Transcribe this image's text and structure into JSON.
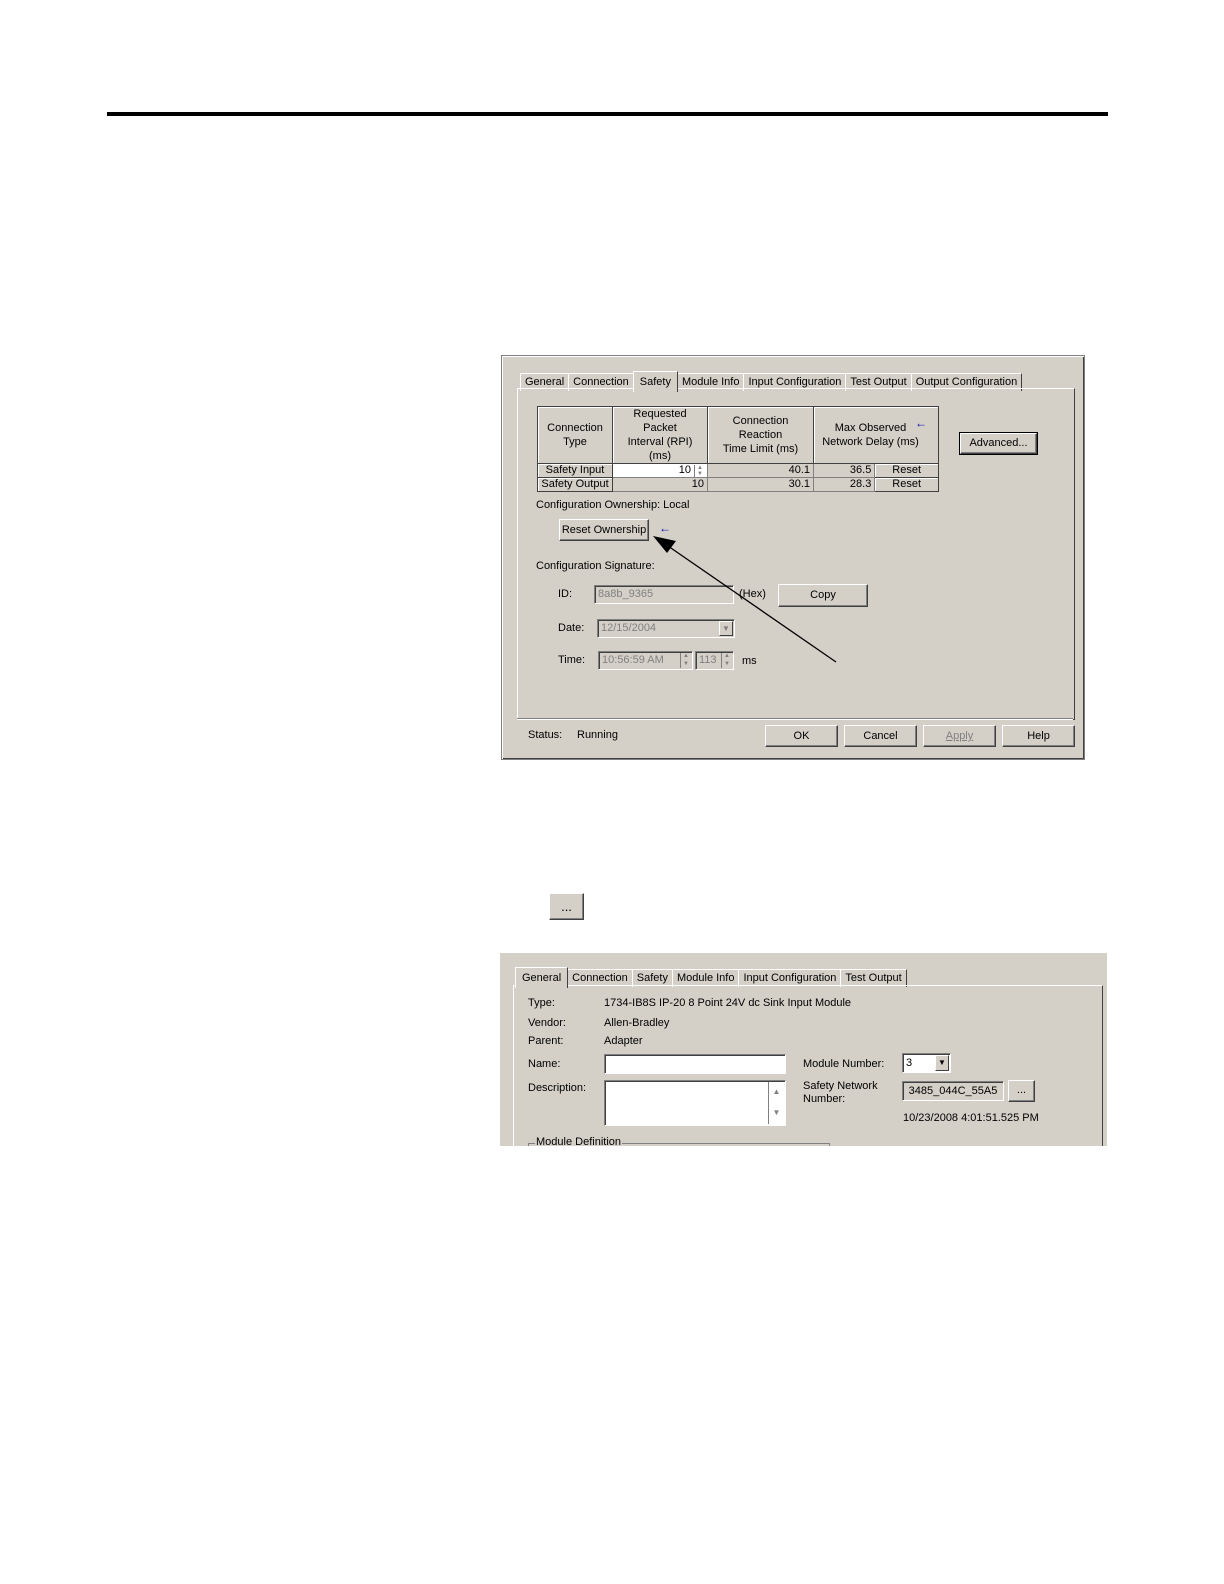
{
  "dialog1": {
    "tabs": [
      "General",
      "Connection",
      "Safety",
      "Module Info",
      "Input Configuration",
      "Test Output",
      "Output Configuration"
    ],
    "active_tab": "Safety",
    "table": {
      "headers": [
        "Connection Type",
        "Requested Packet Interval (RPI) (ms)",
        "Connection Reaction Time Limit (ms)",
        "Max Observed Network Delay (ms)"
      ],
      "header_lines": [
        [
          "Connection",
          "Type"
        ],
        [
          "Requested Packet",
          "Interval (RPI) (ms)"
        ],
        [
          "Connection Reaction",
          "Time Limit (ms)"
        ],
        [
          "Max Observed",
          "Network Delay (ms)"
        ]
      ],
      "rows": [
        {
          "type": "Safety Input",
          "rpi": "10",
          "reaction": "40.1",
          "delay": "36.5",
          "reset": "Reset"
        },
        {
          "type": "Safety Output",
          "rpi": "10",
          "reaction": "30.1",
          "delay": "28.3",
          "reset": "Reset"
        }
      ]
    },
    "advanced_label": "Advanced...",
    "ownership_label": "Configuration Ownership: Local",
    "reset_ownership_label": "Reset Ownership",
    "signature_label": "Configuration Signature:",
    "id_label": "ID:",
    "id_value": "8a8b_9365",
    "hex_label": "(Hex)",
    "copy_label": "Copy",
    "date_label": "Date:",
    "date_value": "12/15/2004",
    "time_label": "Time:",
    "time_value": "10:56:59 AM",
    "ms_value": "113",
    "ms_label": "ms",
    "status_label": "Status:",
    "status_value": "Running",
    "ok_label": "OK",
    "cancel_label": "Cancel",
    "apply_label": "Apply",
    "help_label": "Help",
    "arrow_glyph": "←"
  },
  "ellipsis_button": "...",
  "dialog2": {
    "tabs": [
      "General",
      "Connection",
      "Safety",
      "Module Info",
      "Input Configuration",
      "Test Output"
    ],
    "active_tab": "General",
    "type_label": "Type:",
    "type_value": "1734-IB8S IP-20 8 Point 24V dc Sink Input Module",
    "vendor_label": "Vendor:",
    "vendor_value": "Allen-Bradley",
    "parent_label": "Parent:",
    "parent_value": "Adapter",
    "name_label": "Name:",
    "name_value": "",
    "description_label": "Description:",
    "module_number_label": "Module Number:",
    "module_number_value": "3",
    "safety_network_label_1": "Safety Network",
    "safety_network_label_2": "Number:",
    "safety_network_value": "3485_044C_55A5",
    "snn_button": "...",
    "timestamp": "10/23/2008 4:01:51.525 PM",
    "module_definition_label": "Module Definition"
  }
}
